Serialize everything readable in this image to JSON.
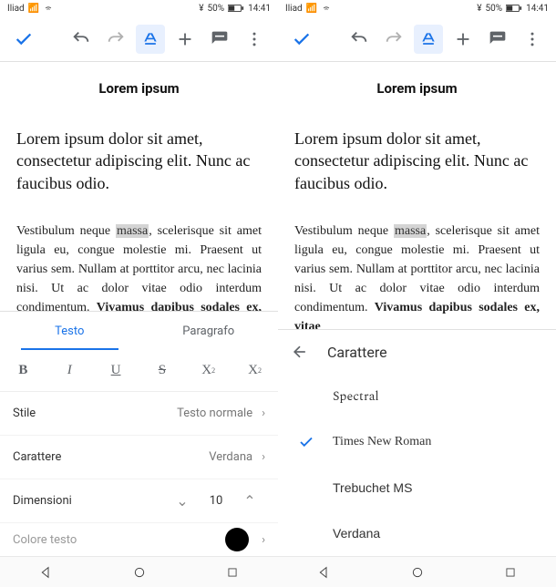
{
  "status": {
    "carrier": "Iliad",
    "battery_pct": "50%",
    "time": "14:41",
    "battery_icon": "◧"
  },
  "doc": {
    "title": "Lorem ipsum",
    "heading": "Lorem ipsum dolor sit amet, consectetur adipiscing elit. Nunc ac faucibus odio.",
    "para_pre": "Vestibulum neque ",
    "para_hl": "massa",
    "para_post": ", scelerisque sit amet ligula eu, congue molestie mi. Praesent ut varius sem. Nullam at porttitor arcu, nec lacinia nisi. Ut ac dolor vitae odio interdum condimentum. ",
    "para_bold": "Vivamus dapibus sodales ex, vitae"
  },
  "tabs": {
    "text": "Testo",
    "paragraph": "Paragrafo"
  },
  "style": {
    "label": "Stile",
    "value": "Testo normale"
  },
  "font": {
    "label": "Carattere",
    "value": "Verdana",
    "header": "Carattere"
  },
  "size": {
    "label": "Dimensioni",
    "value": "10"
  },
  "color": {
    "label": "Colore testo"
  },
  "fonts": {
    "spectral": "Spectral",
    "tnr": "Times New Roman",
    "trebuchet": "Trebuchet MS",
    "verdana": "Verdana"
  },
  "glyph": {
    "yen": "¥"
  }
}
